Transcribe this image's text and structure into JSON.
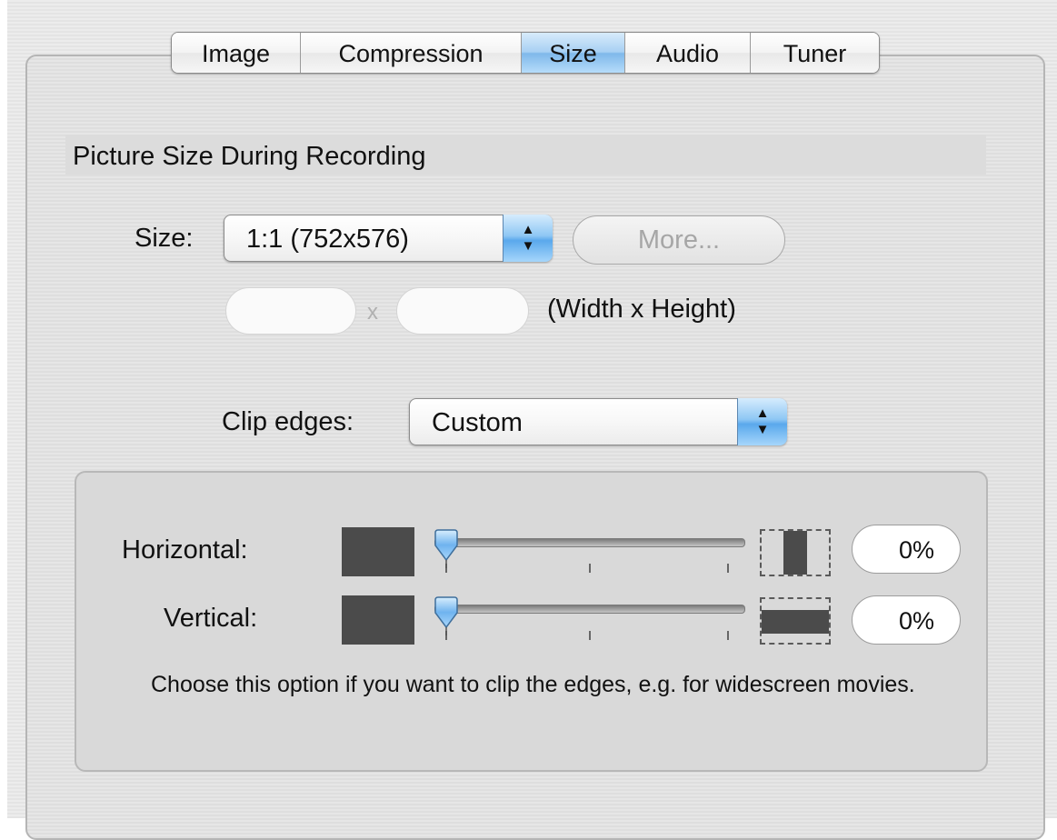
{
  "tabs": [
    {
      "label": "Image",
      "selected": false
    },
    {
      "label": "Compression",
      "selected": false
    },
    {
      "label": "Size",
      "selected": true
    },
    {
      "label": "Audio",
      "selected": false
    },
    {
      "label": "Tuner",
      "selected": false
    }
  ],
  "section_title": "Picture Size During Recording",
  "size": {
    "label": "Size:",
    "selected_value": "1:1 (752x576)",
    "more_button": "More...",
    "width_value": "",
    "height_value": "",
    "separator": "x",
    "dimension_hint": "(Width x Height)"
  },
  "clip_edges": {
    "label": "Clip edges:",
    "selected_value": "Custom"
  },
  "horizontal": {
    "label": "Horizontal:",
    "value_text": "0%",
    "slider_value": 0
  },
  "vertical": {
    "label": "Vertical:",
    "value_text": "0%",
    "slider_value": 0
  },
  "help_text": "Choose this option if you want to clip the edges, e.g. for widescreen movies.",
  "colors": {
    "selected_tab": "#8ec7f4",
    "accent": "#5aa8ec"
  }
}
